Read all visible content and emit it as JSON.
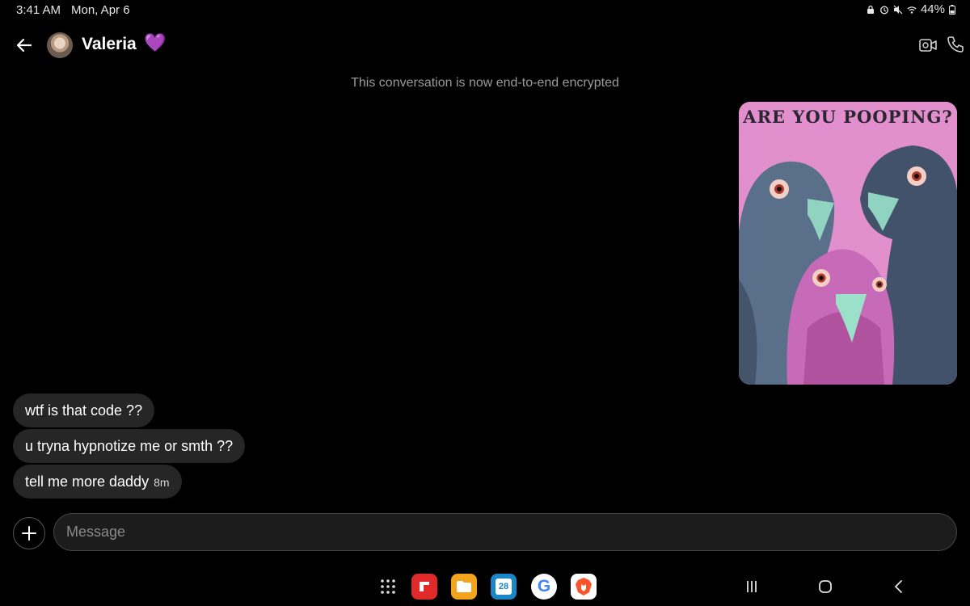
{
  "status_bar": {
    "time": "3:41 AM",
    "date": "Mon, Apr 6",
    "battery": "44%",
    "icons": [
      "lock-icon",
      "alarm-icon",
      "mute-icon",
      "wifi-icon",
      "battery-icon"
    ]
  },
  "header": {
    "contact_name": "Valeria",
    "name_emoji": "💜",
    "icons": [
      "back-arrow-icon",
      "avatar",
      "video-call-icon",
      "phone-icon"
    ]
  },
  "encryption_notice": "This conversation is now end-to-end encrypted",
  "image_message": {
    "caption": "ARE YOU POOPING?",
    "direction": "sent"
  },
  "messages": [
    {
      "text": "wtf is that code ??"
    },
    {
      "text": "u tryna hypnotize me or smth ??"
    },
    {
      "text": "tell me more daddy",
      "timestamp": "8m"
    }
  ],
  "composer": {
    "placeholder": "Message"
  },
  "dock": {
    "calendar_day": "28",
    "google_letter": "G",
    "apps": [
      "app-drawer-icon",
      "flipboard-app-icon",
      "files-app-icon",
      "calendar-app-icon",
      "google-app-icon",
      "brave-app-icon"
    ]
  },
  "colors": {
    "background": "#000000",
    "bubble": "#262626",
    "accent": "#a855f7",
    "image_bg": "#e28fcd"
  }
}
